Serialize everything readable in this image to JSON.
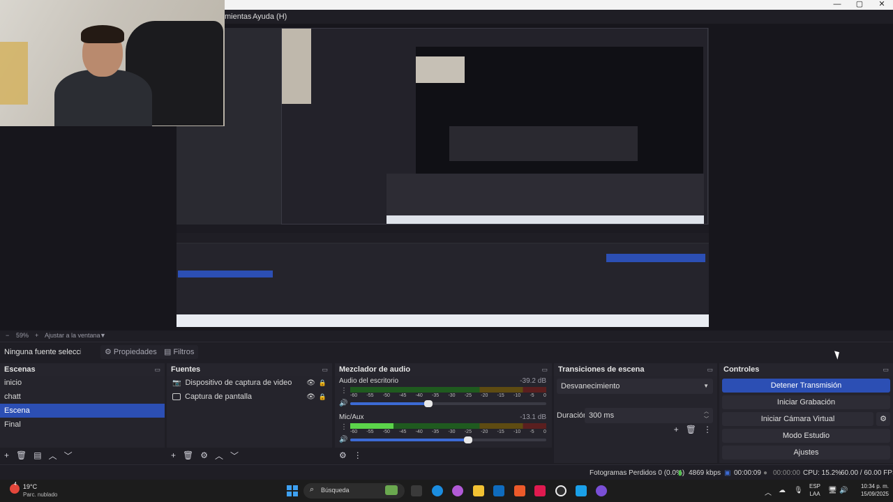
{
  "window": {
    "min": "—",
    "max": "▢",
    "close": "✕"
  },
  "menu": {
    "tools": "mientas",
    "help": "Ayuda (H)"
  },
  "zoom": {
    "minus": "−",
    "percent": "59%",
    "fit": "Ajustar a la ventana"
  },
  "source_toolbar": {
    "no_source": "Ninguna fuente seleccionada",
    "properties": "Propiedades",
    "filters": "Filtros"
  },
  "scenes": {
    "title": "Escenas",
    "items": [
      "inicio",
      "chatt",
      "Escena",
      "Final"
    ],
    "selected": 2
  },
  "sources": {
    "title": "Fuentes",
    "items": [
      "Dispositivo de captura de video",
      "Captura de pantalla"
    ]
  },
  "mixer": {
    "title": "Mezclador de audio",
    "channels": [
      {
        "name": "Audio del escritorio",
        "db": "-39.2 dB",
        "level": 0.0,
        "volume": 0.4
      },
      {
        "name": "Mic/Aux",
        "db": "-13.1 dB",
        "level": 0.22,
        "volume": 0.6
      }
    ],
    "scale": [
      "-60",
      "-55",
      "-50",
      "-45",
      "-40",
      "-35",
      "-30",
      "-25",
      "-20",
      "-15",
      "-10",
      "-5",
      "0"
    ]
  },
  "transitions": {
    "title": "Transiciones de escena",
    "type": "Desvanecimiento",
    "duration_label": "Duración",
    "duration": "300 ms"
  },
  "controls": {
    "title": "Controles",
    "stop_stream": "Detener Transmisión",
    "start_record": "Iniciar Grabación",
    "start_vcam": "Iniciar Cámara Virtual",
    "studio": "Modo Estudio",
    "settings": "Ajustes"
  },
  "status": {
    "dropped": "Fotogramas Perdidos 0 (0.0%)",
    "bitrate": "4869 kbps",
    "stream_time": "00:00:09",
    "rec_time": "00:00:00",
    "cpu": "CPU: 15.2%",
    "fps": "60.00 / 60.00 FPS"
  },
  "taskbar": {
    "temp": "19°C",
    "condition": "Parc. nublado",
    "search": "Búsqueda",
    "lang1": "ESP",
    "lang2": "LAA",
    "time": "10:34 p. m.",
    "date": "15/09/2025",
    "badge": "4"
  },
  "colors": {
    "accent": "#2c4fb4",
    "panel": "#25242c",
    "bg": "#1f1e25"
  }
}
